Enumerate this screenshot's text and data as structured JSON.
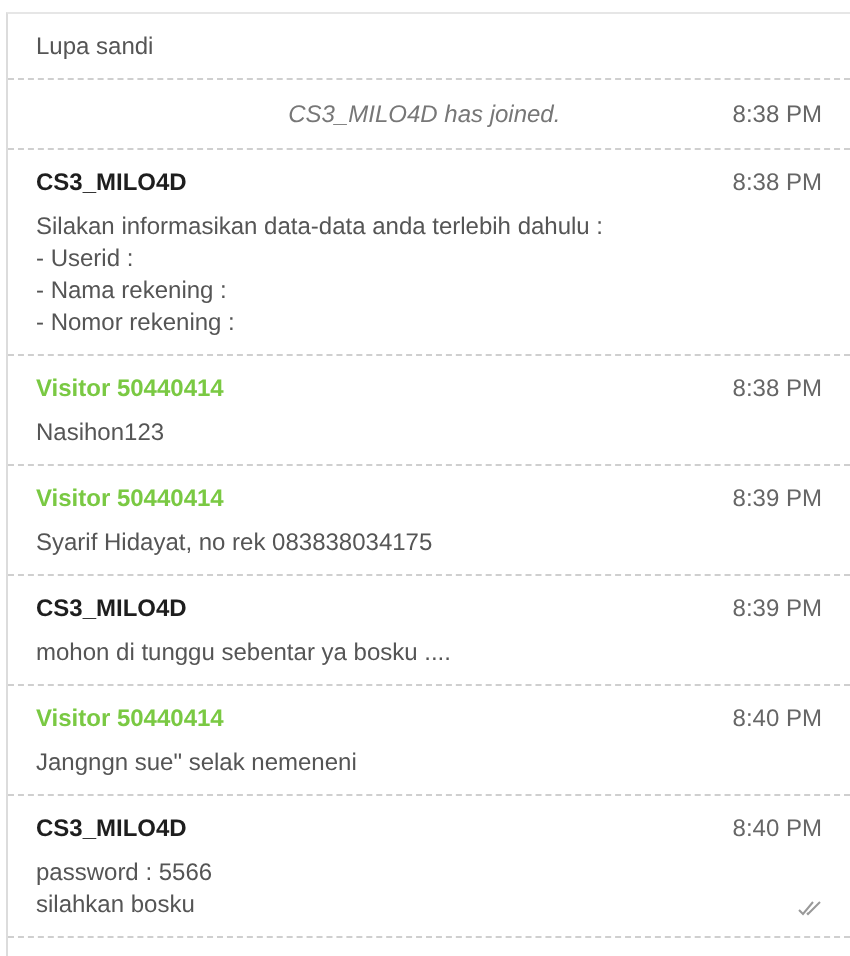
{
  "entries": [
    {
      "kind": "message",
      "lines": [
        "Lupa sandi"
      ]
    },
    {
      "kind": "system",
      "text": "CS3_MILO4D has joined.",
      "time": "8:38 PM"
    },
    {
      "kind": "message",
      "sender": "CS3_MILO4D",
      "color": "#1e1e1e",
      "time": "8:38 PM",
      "lines": [
        "Silakan informasikan data-data anda terlebih dahulu :",
        "- Userid :",
        "- Nama rekening :",
        "- Nomor rekening :"
      ]
    },
    {
      "kind": "message",
      "sender": "Visitor 50440414",
      "color": "#7ac943",
      "time": "8:38 PM",
      "lines": [
        "Nasihon123"
      ]
    },
    {
      "kind": "message",
      "sender": "Visitor 50440414",
      "color": "#7ac943",
      "time": "8:39 PM",
      "lines": [
        "Syarif Hidayat, no rek 083838034175"
      ]
    },
    {
      "kind": "message",
      "sender": "CS3_MILO4D",
      "color": "#1e1e1e",
      "time": "8:39 PM",
      "lines": [
        "mohon di tunggu sebentar ya bosku ...."
      ]
    },
    {
      "kind": "message",
      "sender": "Visitor 50440414",
      "color": "#7ac943",
      "time": "8:40 PM",
      "lines": [
        "Jangngn sue\" selak nemeneni"
      ]
    },
    {
      "kind": "message",
      "sender": "CS3_MILO4D",
      "color": "#1e1e1e",
      "time": "8:40 PM",
      "lines": [
        "password : 5566",
        "silahkan bosku"
      ],
      "read": true
    }
  ]
}
